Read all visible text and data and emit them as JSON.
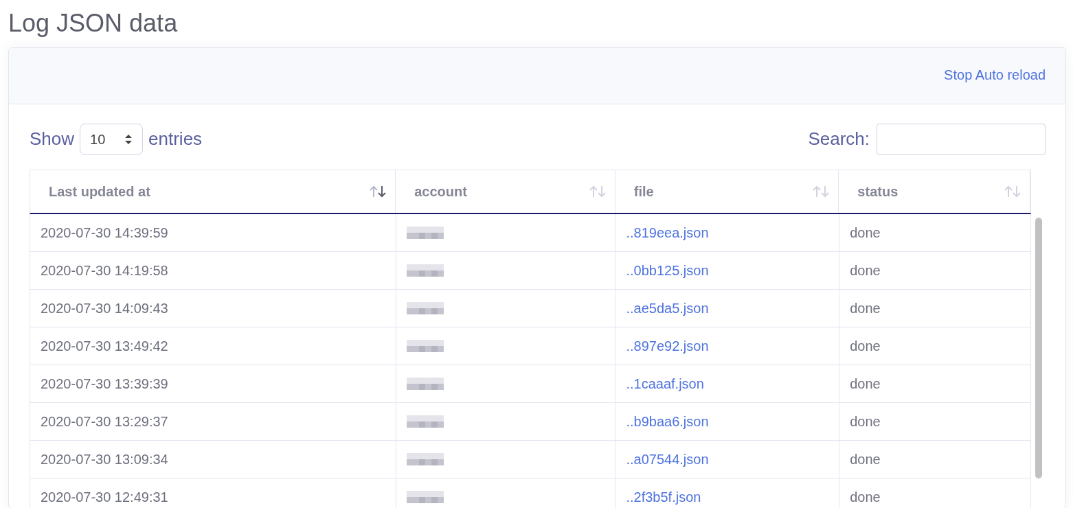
{
  "page_title": "Log JSON data",
  "card_header": {
    "link": "Stop Auto reload"
  },
  "length_control": {
    "prefix": "Show",
    "value": "10",
    "suffix": "entries"
  },
  "search": {
    "label": "Search:"
  },
  "table": {
    "columns": [
      {
        "label": "Last updated at",
        "sorted": true
      },
      {
        "label": "account",
        "sorted": false
      },
      {
        "label": "file",
        "sorted": false
      },
      {
        "label": "status",
        "sorted": false
      }
    ],
    "rows": [
      {
        "updated": "2020-07-30 14:39:59",
        "file": "..819eea.json",
        "status": "done"
      },
      {
        "updated": "2020-07-30 14:19:58",
        "file": "..0bb125.json",
        "status": "done"
      },
      {
        "updated": "2020-07-30 14:09:43",
        "file": "..ae5da5.json",
        "status": "done"
      },
      {
        "updated": "2020-07-30 13:49:42",
        "file": "..897e92.json",
        "status": "done"
      },
      {
        "updated": "2020-07-30 13:39:39",
        "file": "..1caaaf.json",
        "status": "done"
      },
      {
        "updated": "2020-07-30 13:29:37",
        "file": "..b9baa6.json",
        "status": "done"
      },
      {
        "updated": "2020-07-30 13:09:34",
        "file": "..a07544.json",
        "status": "done"
      },
      {
        "updated": "2020-07-30 12:49:31",
        "file": "..2f3b5f.json",
        "status": "done"
      }
    ]
  }
}
